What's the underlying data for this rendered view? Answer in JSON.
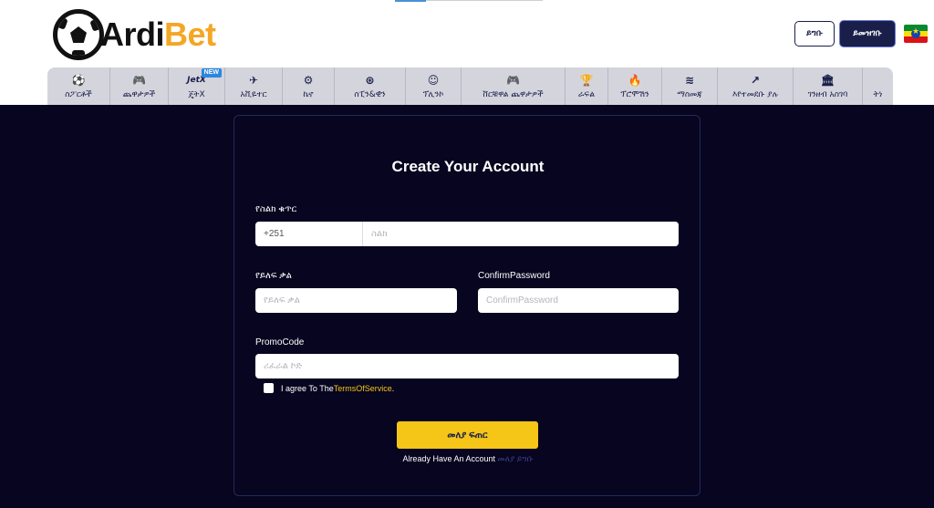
{
  "header": {
    "logo": {
      "part1": "Ardi",
      "part2": "Bet"
    },
    "login_label": "ይግቡ",
    "register_label": "ይመዝገቡ",
    "flag": "ethiopia-flag",
    "colors": {
      "brand_dark": "#1a1f4a",
      "brand_orange": "#f5a623",
      "accent_yellow": "#f5c518",
      "background": "#07051f"
    }
  },
  "nav": {
    "items": [
      {
        "icon": "sports-ball-icon",
        "glyph": "⚽",
        "label": "ስፖርቶች"
      },
      {
        "icon": "gamepad-icon",
        "glyph": "🎮",
        "label": "ጨዋታዎች"
      },
      {
        "icon": "jetx-icon",
        "glyph": "JetX",
        "label": "ጄትX",
        "badge": "NEW"
      },
      {
        "icon": "aviator-icon",
        "glyph": "✈",
        "label": "አቪዬተር"
      },
      {
        "icon": "keno-icon",
        "glyph": "⚙",
        "label": "ኬኖ"
      },
      {
        "icon": "spin-wheel-icon",
        "glyph": "⊛",
        "label": "ስፒን&ዊን"
      },
      {
        "icon": "plinko-icon",
        "glyph": "☺",
        "label": "ፕሊንኮ"
      },
      {
        "icon": "controller-icon",
        "glyph": "🎮",
        "label": "ቨርቹዋል ጨዋታዎች"
      },
      {
        "icon": "trophy-icon",
        "glyph": "🏆",
        "label": "ራፍል"
      },
      {
        "icon": "flame-icon",
        "glyph": "🔥",
        "label": "ፕሮሞሽን"
      },
      {
        "icon": "layers-icon",
        "glyph": "≋",
        "label": "ማስመጃ"
      },
      {
        "icon": "trend-up-icon",
        "glyph": "↗",
        "label": "እየተመደቡ ያሉ"
      },
      {
        "icon": "bank-icon",
        "glyph": "🏛",
        "label": "ገንዘብ አስገባ"
      },
      {
        "icon": "more-icon",
        "glyph": "",
        "label": "ትነ"
      }
    ]
  },
  "form": {
    "title": "Create Your Account",
    "phone": {
      "label": "የስልክ ቁጥር",
      "code": "+251",
      "placeholder": "ስልክ"
    },
    "password": {
      "label": "የይለፍ ቃል",
      "placeholder": "የይለፍ ቃል"
    },
    "confirm": {
      "label": "ConfirmPassword",
      "placeholder": "ConfirmPassword"
    },
    "promo": {
      "label": "PromoCode",
      "placeholder": "ሪፈራል ኮድ"
    },
    "agree_text": "I agree To The ",
    "tos_link": "TermsOfService",
    "agree_end": ".",
    "submit_label": "መለያ ፍጠር",
    "already_text": "Already Have An Account ",
    "already_link": "መለያ ይግቡ"
  }
}
